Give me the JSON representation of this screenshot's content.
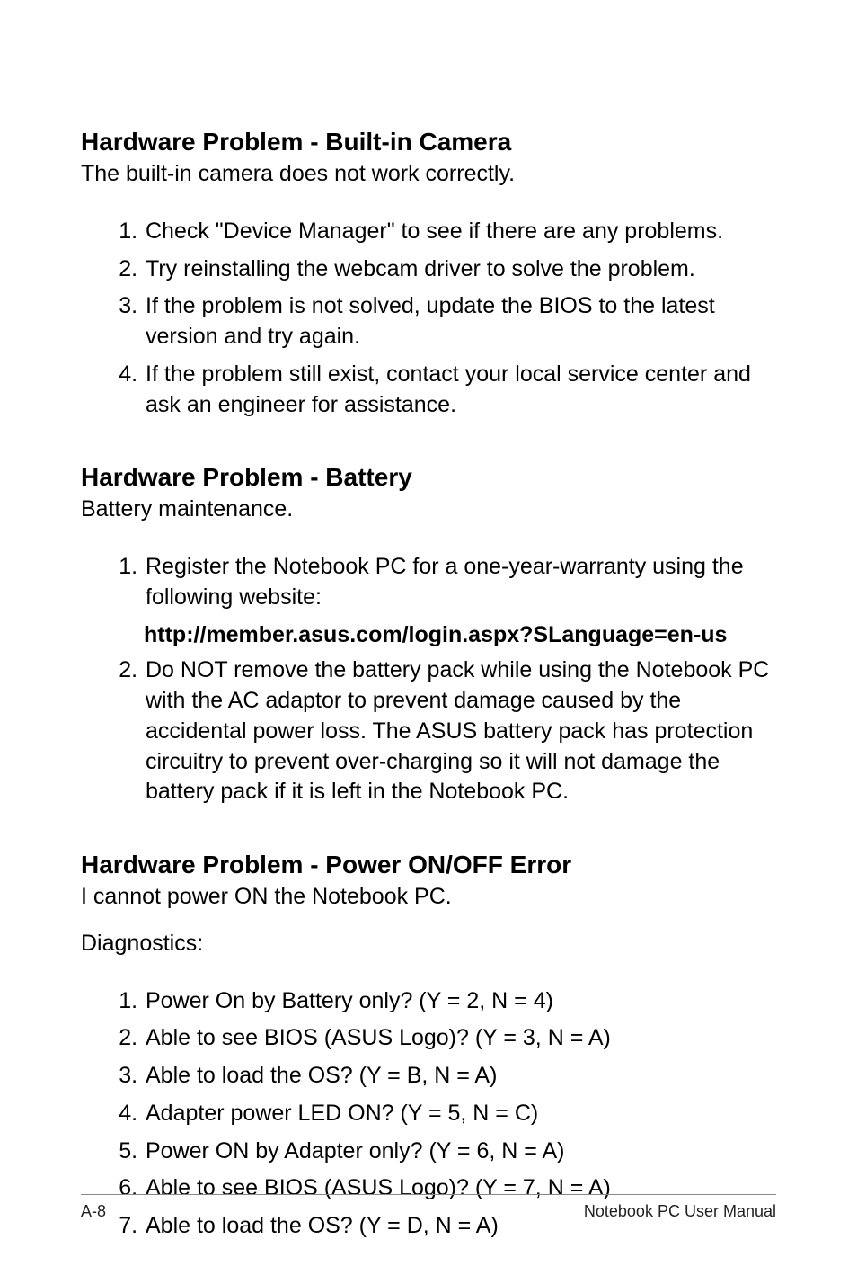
{
  "sections": [
    {
      "heading": "Hardware Problem - Built-in Camera",
      "intro": "The built-in camera does not work correctly.",
      "items": [
        "Check \"Device Manager\" to see if there are any problems.",
        "Try reinstalling the webcam driver to solve the problem.",
        "If the problem is not solved, update the BIOS to the latest version and try again.",
        "If the problem still exist, contact your local service center and ask an engineer for assistance."
      ]
    },
    {
      "heading": "Hardware Problem - Battery",
      "intro": "Battery maintenance.",
      "items": [
        "Register the Notebook PC for a one-year-warranty using the following website:",
        "Do NOT remove the battery pack while using the Notebook PC with the AC adaptor to prevent damage caused by the accidental power loss. The ASUS battery pack has protection circuitry to prevent over-charging so it will not damage the battery pack if it is left in the Notebook PC."
      ],
      "inline_bold_after_item_1": "http://member.asus.com/login.aspx?SLanguage=en-us"
    },
    {
      "heading": "Hardware Problem - Power ON/OFF Error",
      "intro": "I cannot power ON the Notebook PC.",
      "subintro": "Diagnostics:",
      "items": [
        "Power On by Battery only? (Y = 2, N = 4)",
        "Able to see BIOS (ASUS Logo)? (Y = 3, N = A)",
        "Able to load the OS? (Y = B, N = A)",
        "Adapter power LED ON? (Y = 5, N = C)",
        "Power ON by Adapter only? (Y = 6, N = A)",
        "Able to see BIOS (ASUS Logo)? (Y = 7, N = A)",
        "Able to load the OS? (Y = D, N = A)"
      ]
    }
  ],
  "footer": {
    "left": "A-8",
    "right": "Notebook PC User Manual"
  }
}
